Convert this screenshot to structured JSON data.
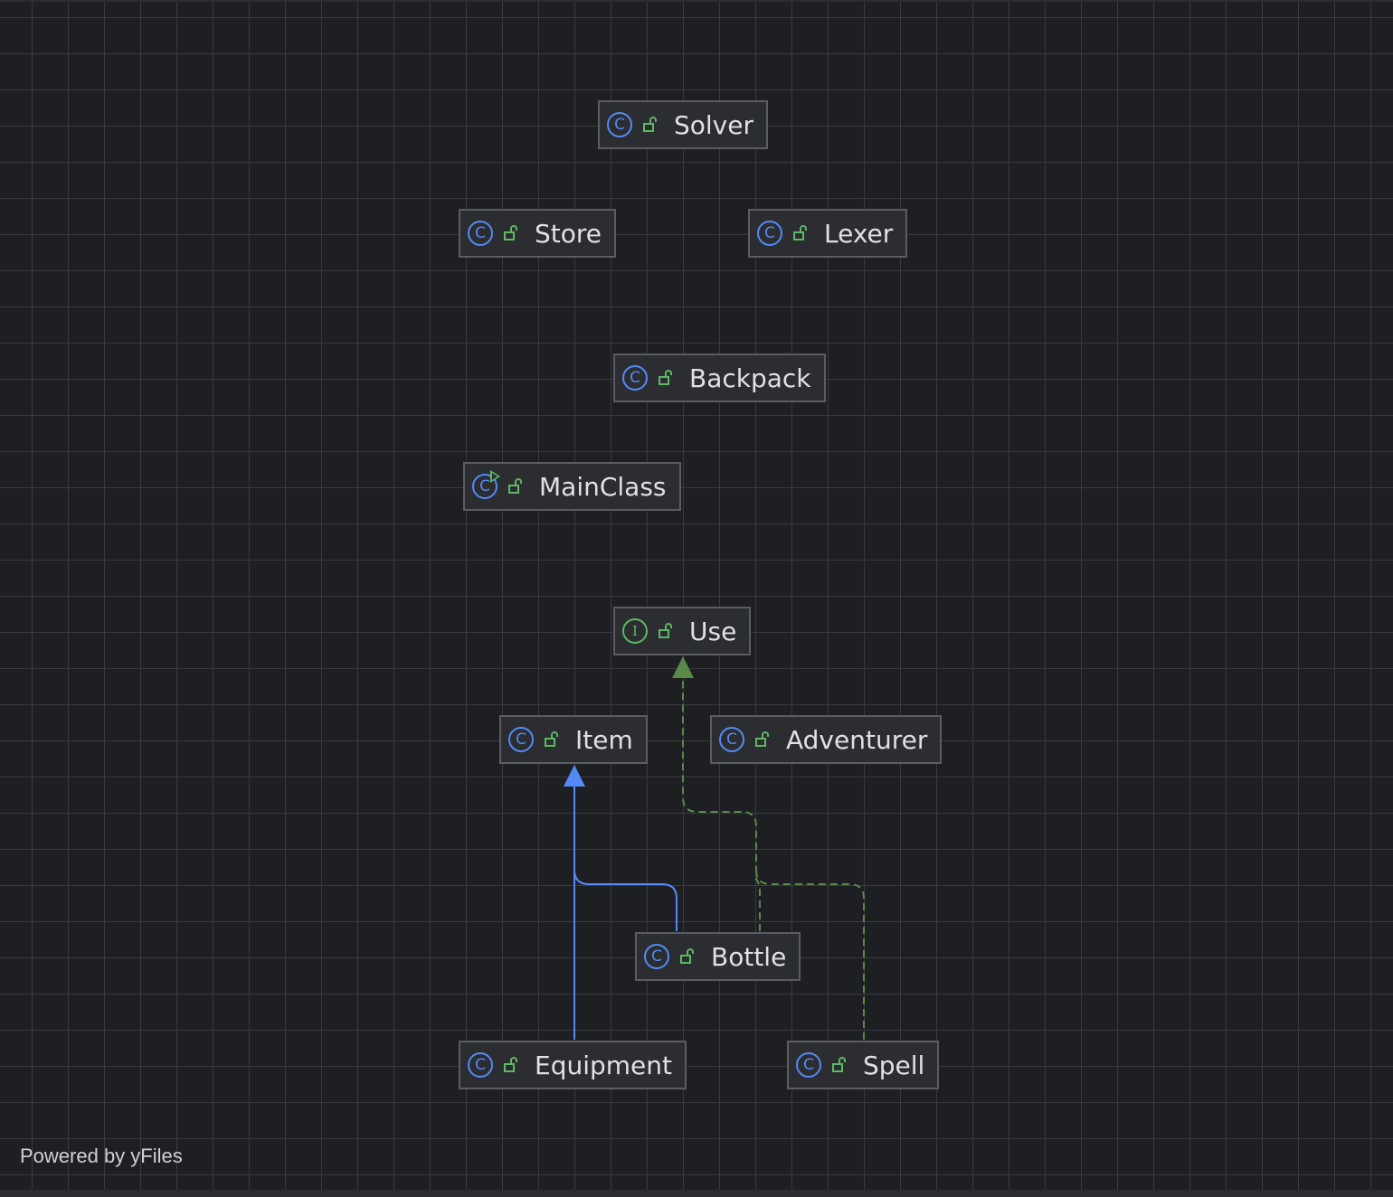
{
  "diagram": {
    "nodes": [
      {
        "id": "solver",
        "label": "Solver",
        "kind": "class",
        "icon": "class-icon"
      },
      {
        "id": "store",
        "label": "Store",
        "kind": "class",
        "icon": "class-icon"
      },
      {
        "id": "lexer",
        "label": "Lexer",
        "kind": "class",
        "icon": "class-icon"
      },
      {
        "id": "backpack",
        "label": "Backpack",
        "kind": "class",
        "icon": "class-icon"
      },
      {
        "id": "mainclass",
        "label": "MainClass",
        "kind": "runnable-class",
        "icon": "runnable-class-icon"
      },
      {
        "id": "use",
        "label": "Use",
        "kind": "interface",
        "icon": "interface-icon"
      },
      {
        "id": "item",
        "label": "Item",
        "kind": "class",
        "icon": "class-icon"
      },
      {
        "id": "adventurer",
        "label": "Adventurer",
        "kind": "class",
        "icon": "class-icon"
      },
      {
        "id": "bottle",
        "label": "Bottle",
        "kind": "class",
        "icon": "class-icon"
      },
      {
        "id": "equipment",
        "label": "Equipment",
        "kind": "class",
        "icon": "class-icon"
      },
      {
        "id": "spell",
        "label": "Spell",
        "kind": "class",
        "icon": "class-icon"
      }
    ],
    "edges": [
      {
        "from": "equipment",
        "to": "item",
        "type": "extends"
      },
      {
        "from": "bottle",
        "to": "item",
        "type": "extends"
      },
      {
        "from": "bottle",
        "to": "use",
        "type": "implements"
      },
      {
        "from": "spell",
        "to": "use",
        "type": "implements"
      }
    ],
    "colors": {
      "background": "#1e1f22",
      "grid": "#3a3b3e",
      "node_fill": "#2b2d30",
      "node_border": "#5a5d63",
      "class_icon": "#548af7",
      "interface_icon": "#5fb865",
      "extends_edge": "#548af7",
      "implements_edge": "#5a8a4a"
    }
  },
  "footer": {
    "powered_by": "Powered by yFiles"
  }
}
